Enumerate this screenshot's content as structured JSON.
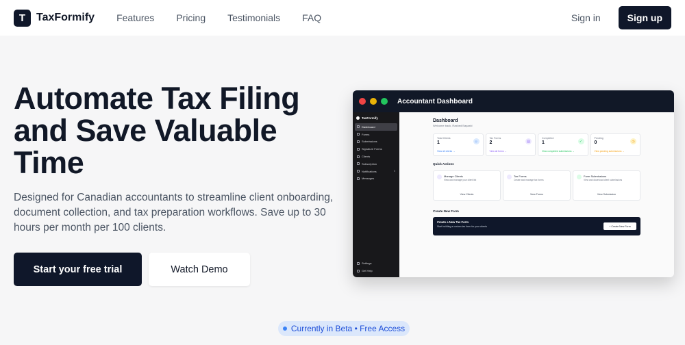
{
  "nav": {
    "logo_letter": "T",
    "brand": "TaxFormify",
    "links": [
      "Features",
      "Pricing",
      "Testimonials",
      "FAQ"
    ],
    "signin": "Sign in",
    "signup": "Sign up"
  },
  "hero": {
    "title": "Automate Tax Filing and Save Valuable Time",
    "subtitle": "Designed for Canadian accountants to streamline client onboarding, document collection, and tax preparation workflows. Save up to 30 hours per month per 100 clients.",
    "primary_cta": "Start your free trial",
    "secondary_cta": "Watch Demo"
  },
  "beta_badge": "Currently in Beta • Free Access",
  "dashboard": {
    "window_title": "Accountant Dashboard",
    "sidebar_brand": "TaxFormify",
    "sidebar_items": [
      {
        "label": "Dashboard",
        "icon": "dashboard-icon"
      },
      {
        "label": "Forms",
        "icon": "forms-icon"
      },
      {
        "label": "Submissions",
        "icon": "submissions-icon"
      },
      {
        "label": "Signature Forms",
        "icon": "signature-icon"
      },
      {
        "label": "Clients",
        "icon": "clients-icon"
      },
      {
        "label": "Subscription",
        "icon": "subscription-icon"
      },
      {
        "label": "Notifications",
        "icon": "bell-icon",
        "badge": "0"
      },
      {
        "label": "Messages",
        "icon": "message-icon"
      }
    ],
    "sidebar_bottom": [
      {
        "label": "Settings",
        "icon": "gear-icon"
      },
      {
        "label": "Get Help",
        "icon": "help-icon"
      }
    ],
    "heading": "Dashboard",
    "welcome": "Welcome back, Rashed Bayazid",
    "stats": [
      {
        "label": "Total Clients",
        "value": "1",
        "link": "View all clients →",
        "color": "#3b82f6",
        "bg": "#dbeafe",
        "icon": "users-icon"
      },
      {
        "label": "Tax Forms",
        "value": "2",
        "link": "View all forms →",
        "color": "#8b5cf6",
        "bg": "#ede9fe",
        "icon": "document-icon"
      },
      {
        "label": "Completed",
        "value": "1",
        "link": "View completed submissions →",
        "color": "#22c55e",
        "bg": "#dcfce7",
        "icon": "check-circle-icon"
      },
      {
        "label": "Pending",
        "value": "0",
        "link": "View pending submissions →",
        "color": "#f59e0b",
        "bg": "#fef3c7",
        "icon": "clock-icon"
      }
    ],
    "quick_actions_heading": "Quick Actions",
    "actions": [
      {
        "name": "Manage Clients",
        "desc": "View and manage your client list",
        "link": "View Clients"
      },
      {
        "name": "Tax Forms",
        "desc": "Create and manage tax forms",
        "link": "View Forms"
      },
      {
        "name": "Form Submissions",
        "desc": "View and download client submissions",
        "link": "View Submission"
      }
    ],
    "create_heading": "Create New Form",
    "create_banner_title": "Create a New Tax Form",
    "create_banner_desc": "Start building a custom tax form for your clients",
    "create_button": "+ Create New Form"
  }
}
